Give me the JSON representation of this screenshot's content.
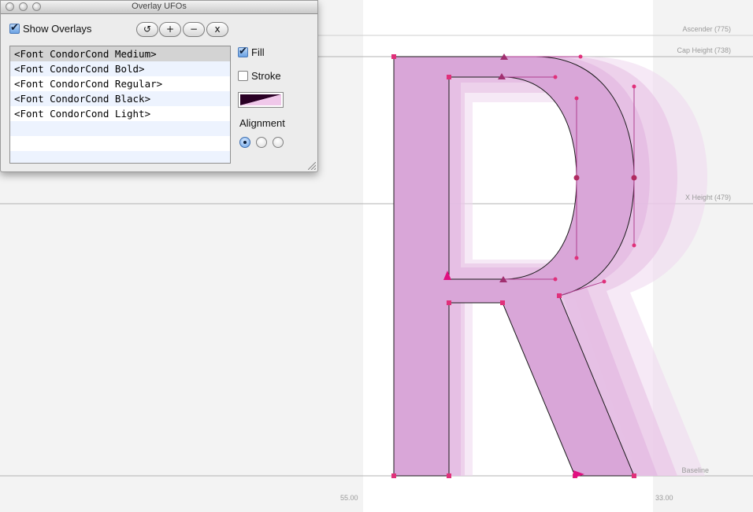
{
  "window": {
    "title": "Overlay UFOs"
  },
  "controls": {
    "show_overlays_label": "Show Overlays",
    "show_overlays_checked": true,
    "buttons": {
      "refresh": "↺",
      "add": "+",
      "remove": "−",
      "close": "x"
    },
    "fill_label": "Fill",
    "fill_checked": true,
    "stroke_label": "Stroke",
    "stroke_checked": false,
    "alignment_label": "Alignment",
    "alignment_selected_index": 0
  },
  "fonts": [
    "<Font CondorCond Medium>",
    "<Font CondorCond Bold>",
    "<Font CondorCond Regular>",
    "<Font CondorCond Black>",
    "<Font CondorCond Light>"
  ],
  "selected_font_index": 0,
  "metrics": {
    "ascender": "Ascender (775)",
    "cap_height": "Cap Height (738)",
    "x_height": "X Height (479)",
    "baseline": "Baseline"
  },
  "sidebearings": {
    "left": "55.00",
    "right": "33.00"
  },
  "colors": {
    "glyph_fill": "#d9a6d8",
    "overlay_fill": "#e9c6e7",
    "point": "#e0307a",
    "canvas_bg": "#f3f3f3",
    "glyph_area": "#ffffff"
  }
}
